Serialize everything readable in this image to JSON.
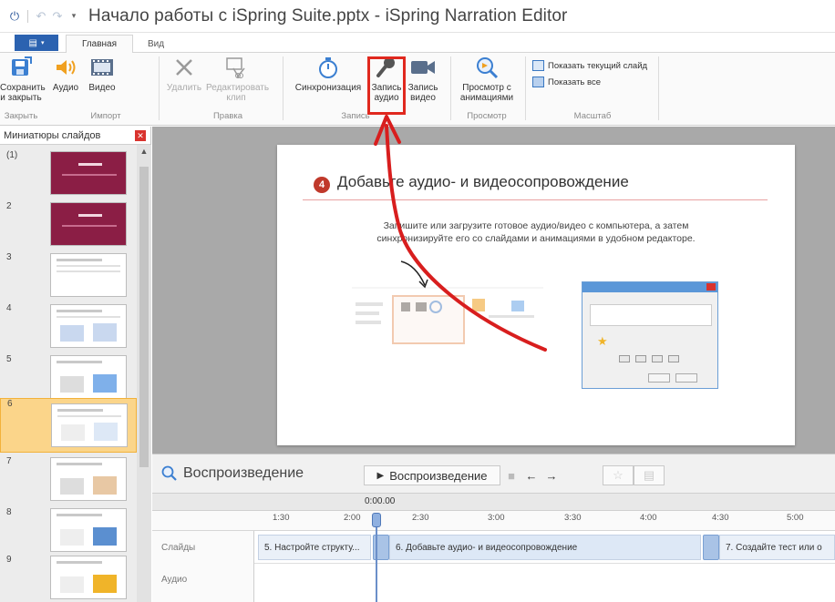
{
  "window": {
    "title": "Начало работы с iSpring Suite.pptx - iSpring Narration Editor"
  },
  "tabs": {
    "file_label": "",
    "home": "Главная",
    "view": "Вид"
  },
  "ribbon": {
    "save_close": "Сохранить и закрыть",
    "audio": "Аудио",
    "video": "Видео",
    "delete": "Удалить",
    "edit_clip": "Редактировать клип",
    "sync": "Синхронизация",
    "record_audio": "Запись аудио",
    "record_video": "Запись видео",
    "preview_anim": "Просмотр с анимациями",
    "show_current": "Показать текущий слайд",
    "show_all": "Показать все",
    "groups": {
      "close": "Закрыть",
      "import": "Импорт",
      "edit": "Правка",
      "record": "Запись",
      "preview": "Просмотр",
      "scale": "Масштаб"
    }
  },
  "slide_panel": {
    "title": "Миниатюры слайдов",
    "thumbs": [
      {
        "num": "(1)"
      },
      {
        "num": "2"
      },
      {
        "num": "3"
      },
      {
        "num": "4"
      },
      {
        "num": "5"
      },
      {
        "num": "6"
      },
      {
        "num": "7"
      },
      {
        "num": "8"
      },
      {
        "num": "9"
      }
    ],
    "selected_index": 6
  },
  "slide": {
    "badge": "4",
    "title": "Добавьте аудио- и видеосопровождение",
    "body_line1": "Запишите или загрузите готовое аудио/видео с компьютера, а затем",
    "body_line2": "синхронизируйте его со слайдами и анимациями в удобном редакторе."
  },
  "timeline": {
    "title": "Воспроизведение",
    "play_label": "Воспроизведение",
    "current_time": "0:00.00",
    "ticks": [
      "1:30",
      "2:00",
      "2:30",
      "3:00",
      "3:30",
      "4:00",
      "4:30",
      "5:00"
    ],
    "track_slides": "Слайды",
    "track_audio": "Аудио",
    "segments": [
      "5. Настройте структу...",
      "6. Добавьте аудио- и видеосопровождение",
      "7. Создайте тест или о"
    ]
  },
  "colors": {
    "accent": "#2b62b0",
    "highlight": "#e0281e",
    "arrow": "#d81e1e"
  }
}
